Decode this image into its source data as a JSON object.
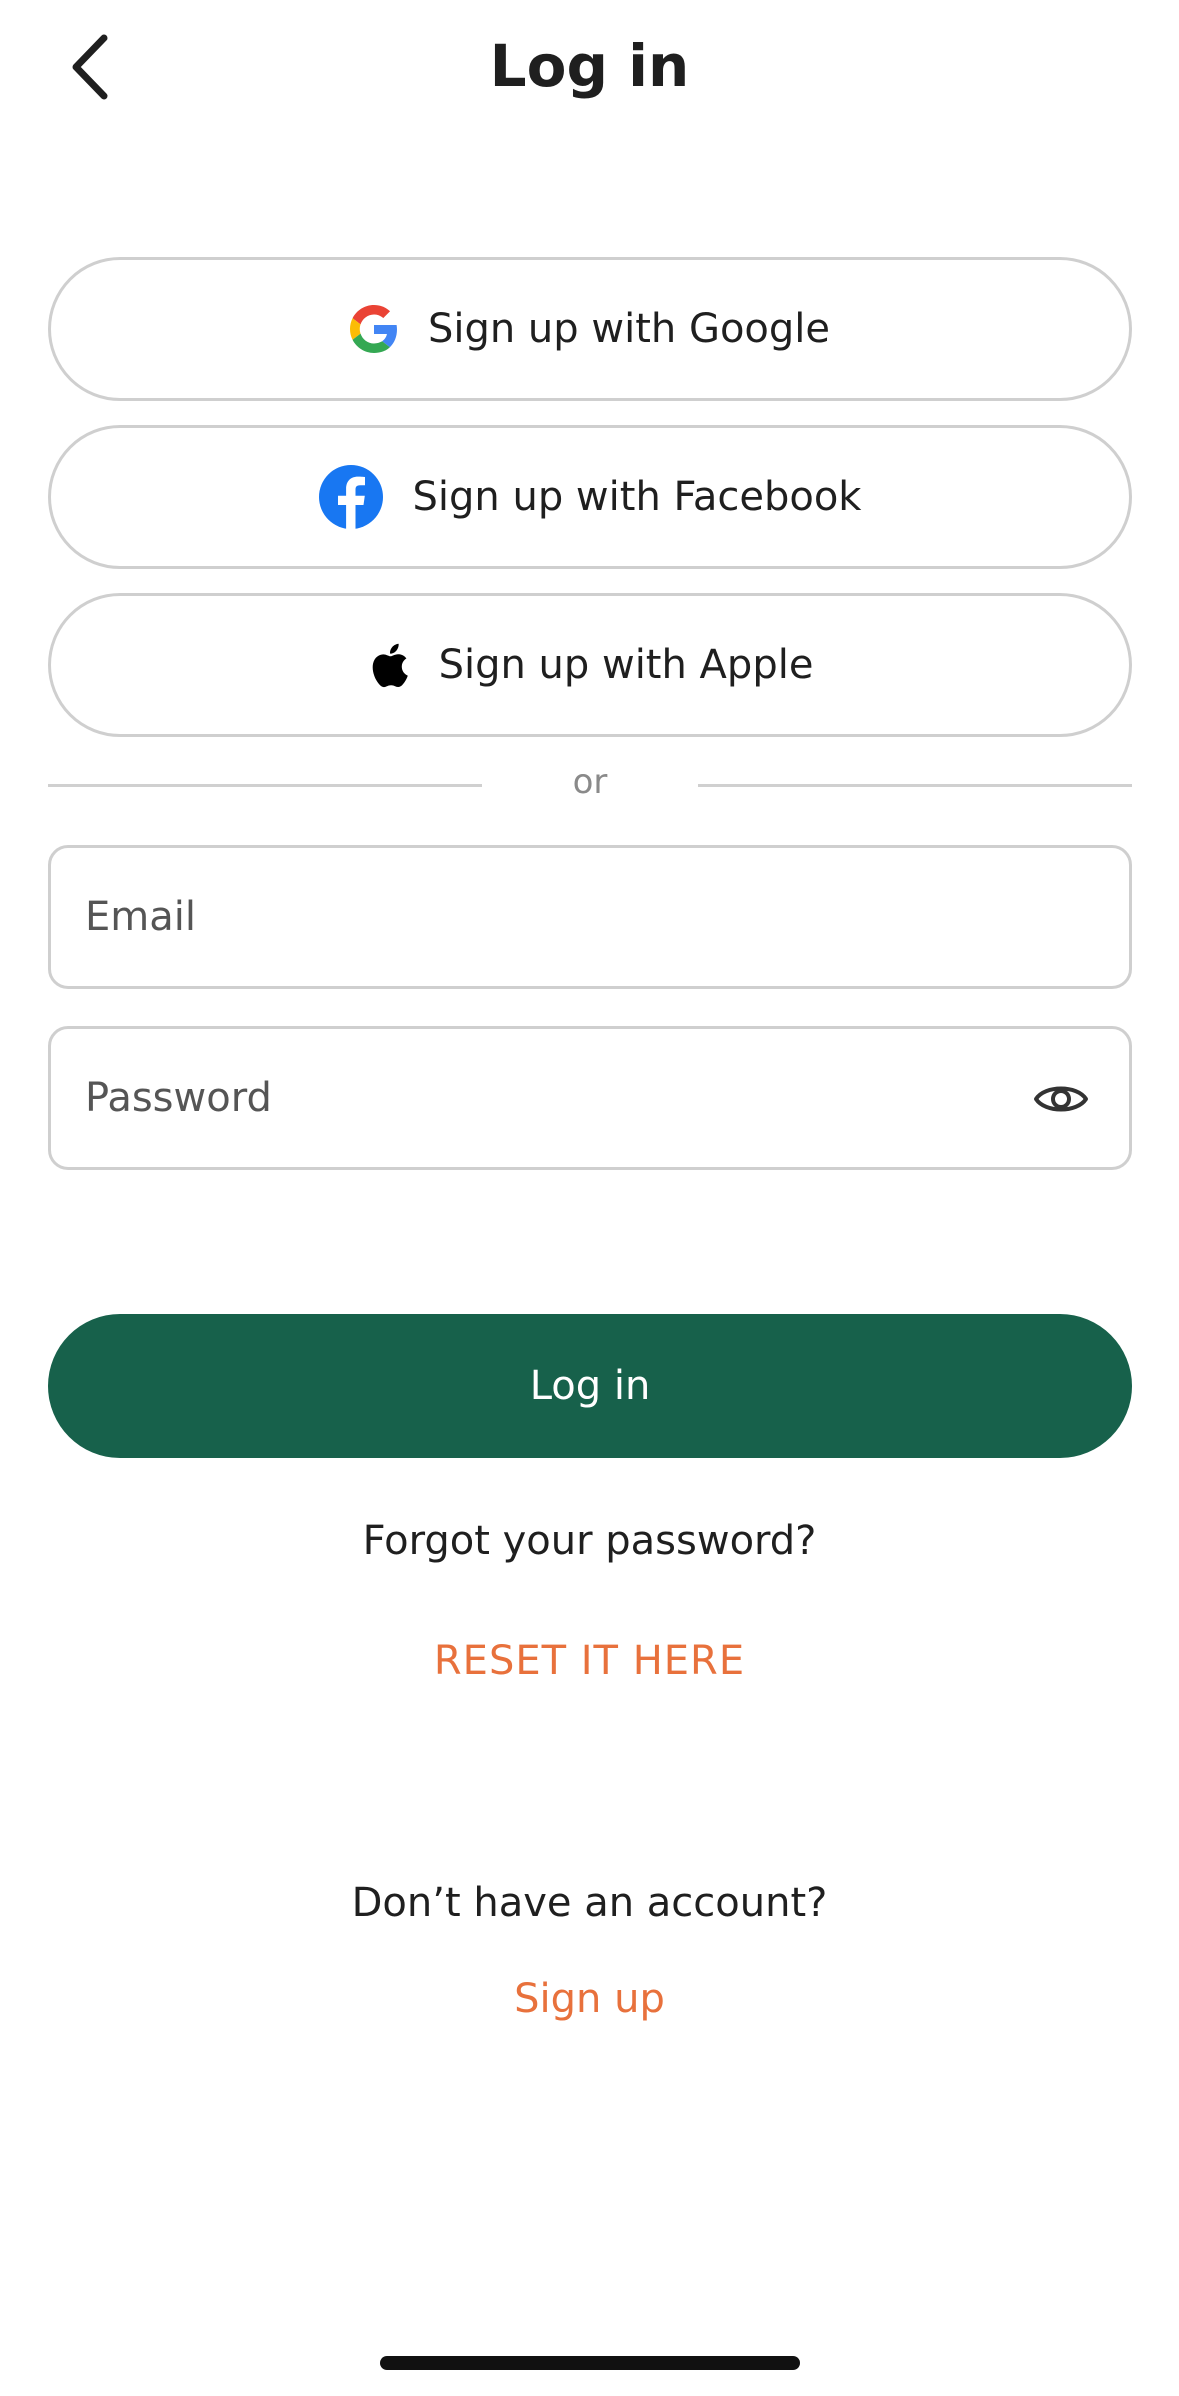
{
  "header": {
    "title": "Log in",
    "back_icon": "chevron-left-icon"
  },
  "social": [
    {
      "label": "Sign up with Google",
      "icon": "google-icon"
    },
    {
      "label": "Sign up with Facebook",
      "icon": "facebook-icon"
    },
    {
      "label": "Sign up with Apple",
      "icon": "apple-icon"
    }
  ],
  "divider": {
    "text": "or"
  },
  "form": {
    "email": {
      "placeholder": "Email",
      "value": ""
    },
    "password": {
      "placeholder": "Password",
      "value": "",
      "toggle_icon": "eye-icon"
    },
    "submit_label": "Log in"
  },
  "forgot": {
    "question": "Forgot your password?",
    "link": "RESET IT HERE"
  },
  "signup": {
    "question": "Don’t have an account?",
    "link": "Sign up"
  },
  "colors": {
    "primary": "#17614b",
    "link": "#e8713c",
    "border": "#cfcfcf",
    "facebook": "#1877f2"
  }
}
